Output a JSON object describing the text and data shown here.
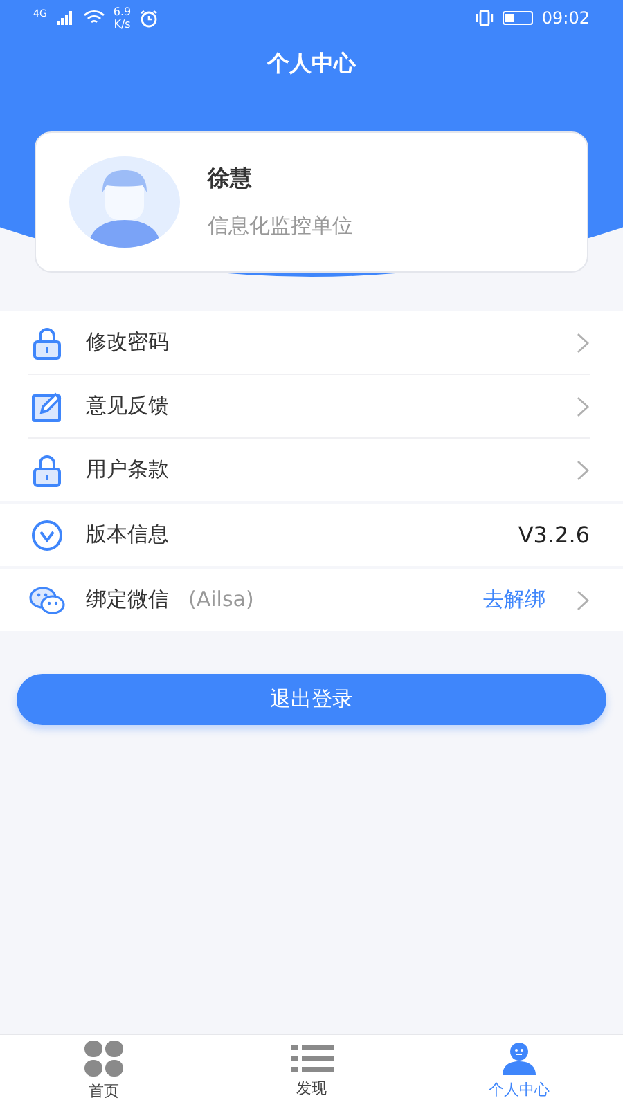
{
  "status_bar": {
    "network": "4G",
    "speed_value": "6.9",
    "speed_unit": "K/s",
    "time": "09:02"
  },
  "header": {
    "title": "个人中心"
  },
  "profile": {
    "name": "徐慧",
    "organization": "信息化监控单位"
  },
  "menu_groups": [
    {
      "rows": [
        {
          "kind": "link",
          "label": "修改密码"
        },
        {
          "kind": "link",
          "label": "意见反馈"
        },
        {
          "kind": "link",
          "label": "用户条款"
        }
      ]
    },
    {
      "rows": [
        {
          "kind": "value",
          "label": "版本信息",
          "value": "V3.2.6"
        }
      ]
    },
    {
      "rows": [
        {
          "kind": "bind",
          "label": "绑定微信",
          "account": "(Ailsa)",
          "action": "去解绑"
        }
      ]
    }
  ],
  "logout_button": "退出登录",
  "tabs": [
    {
      "label": "首页",
      "selected": false
    },
    {
      "label": "发现",
      "selected": false
    },
    {
      "label": "个人中心",
      "selected": true
    }
  ]
}
